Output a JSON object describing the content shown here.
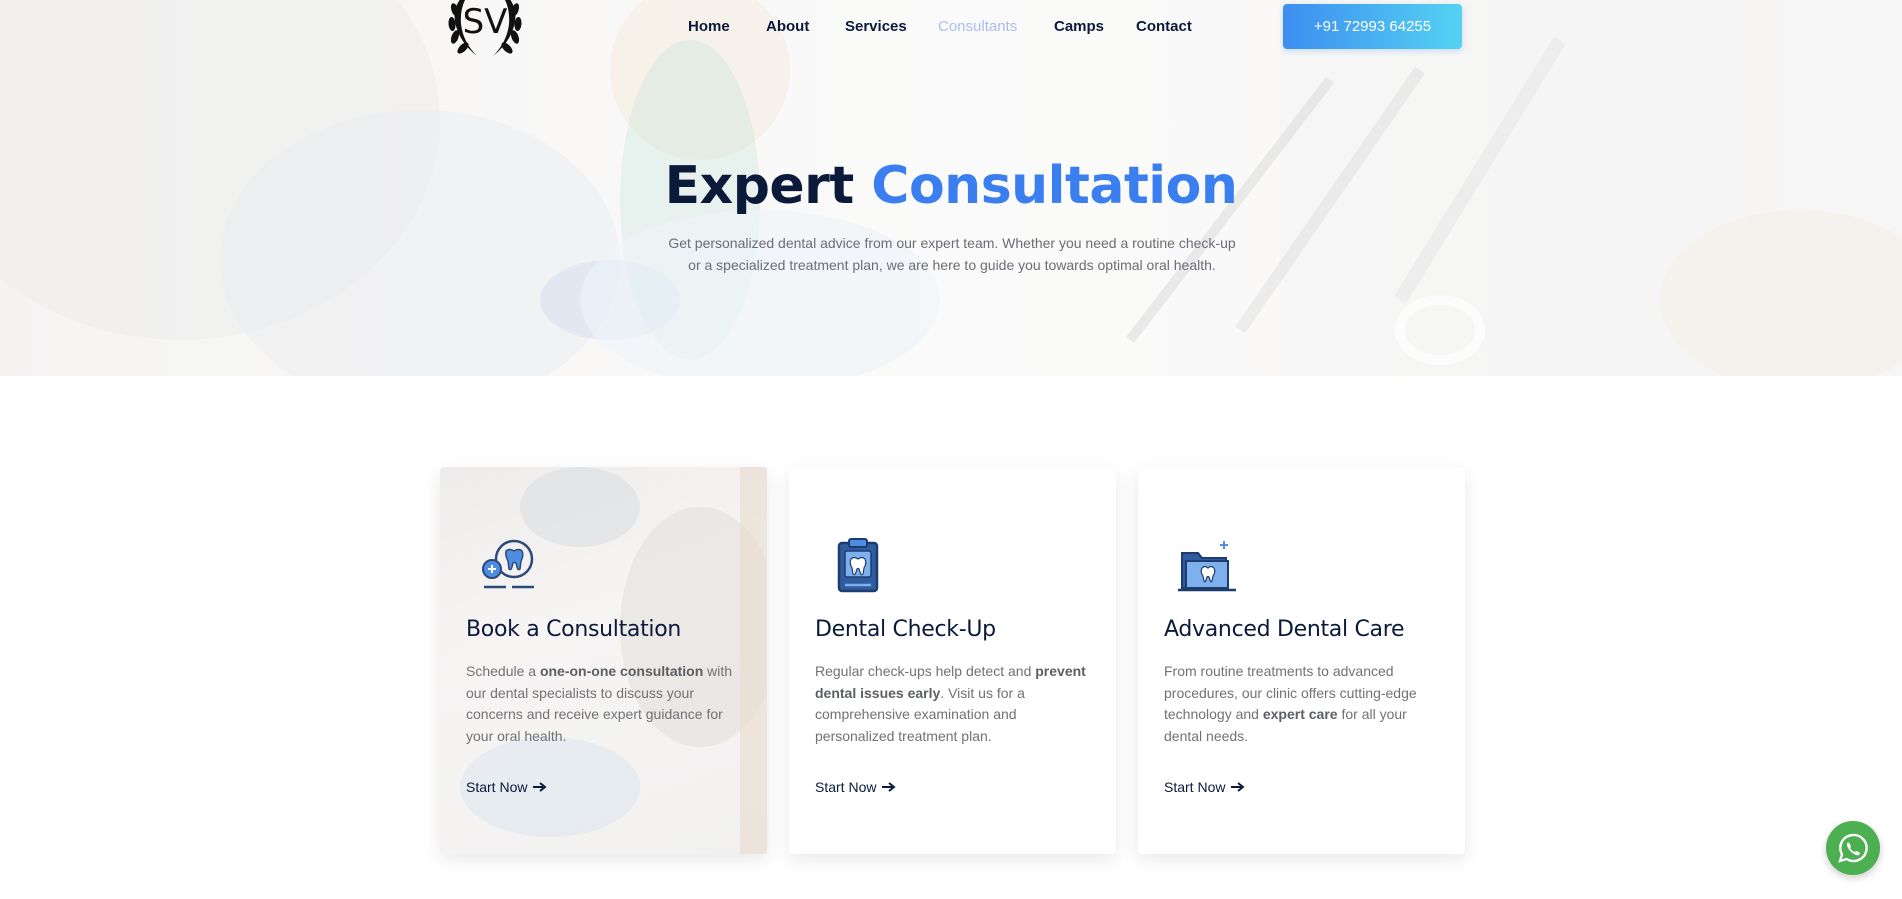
{
  "header": {
    "logo_text": "SV",
    "nav": [
      {
        "label": "Home",
        "active": false
      },
      {
        "label": "About",
        "active": false
      },
      {
        "label": "Services",
        "active": false
      },
      {
        "label": "Consultants",
        "active": true
      },
      {
        "label": "Camps",
        "active": false
      },
      {
        "label": "Contact",
        "active": false
      }
    ],
    "phone_button": "+91 72993 64255"
  },
  "hero": {
    "title_dark": "Expert",
    "title_accent": "Consultation",
    "subtitle_line1": "Get personalized dental advice from our expert team. Whether you need a routine check-up",
    "subtitle_line2": "or a specialized treatment plan, we are here to guide you towards optimal oral health."
  },
  "cards": [
    {
      "icon": "tooth-consultation-icon",
      "title": "Book a Consultation",
      "text_parts": [
        "Schedule a ",
        "one-on-one consultation",
        " with our dental specialists to discuss your concerns and receive expert guidance for your oral health."
      ],
      "link": "Start Now"
    },
    {
      "icon": "tooth-clipboard-icon",
      "title": "Dental Check-Up",
      "text_parts": [
        "Regular check-ups help detect and ",
        "prevent dental issues early",
        ". Visit us for a comprehensive examination and personalized treatment plan."
      ],
      "link": "Start Now"
    },
    {
      "icon": "tooth-folder-icon",
      "title": "Advanced Dental Care",
      "text_parts": [
        "From routine treatments to advanced procedures, our clinic offers cutting-edge technology and ",
        "expert care",
        " for all your dental needs."
      ],
      "link": "Start Now"
    }
  ],
  "floating": {
    "whatsapp_icon": "whatsapp-icon"
  },
  "colors": {
    "navy": "#0b1a3b",
    "accent_blue": "#3a7ef0",
    "nav_active": "#a9bdf0",
    "whatsapp_green": "#4caf50"
  }
}
